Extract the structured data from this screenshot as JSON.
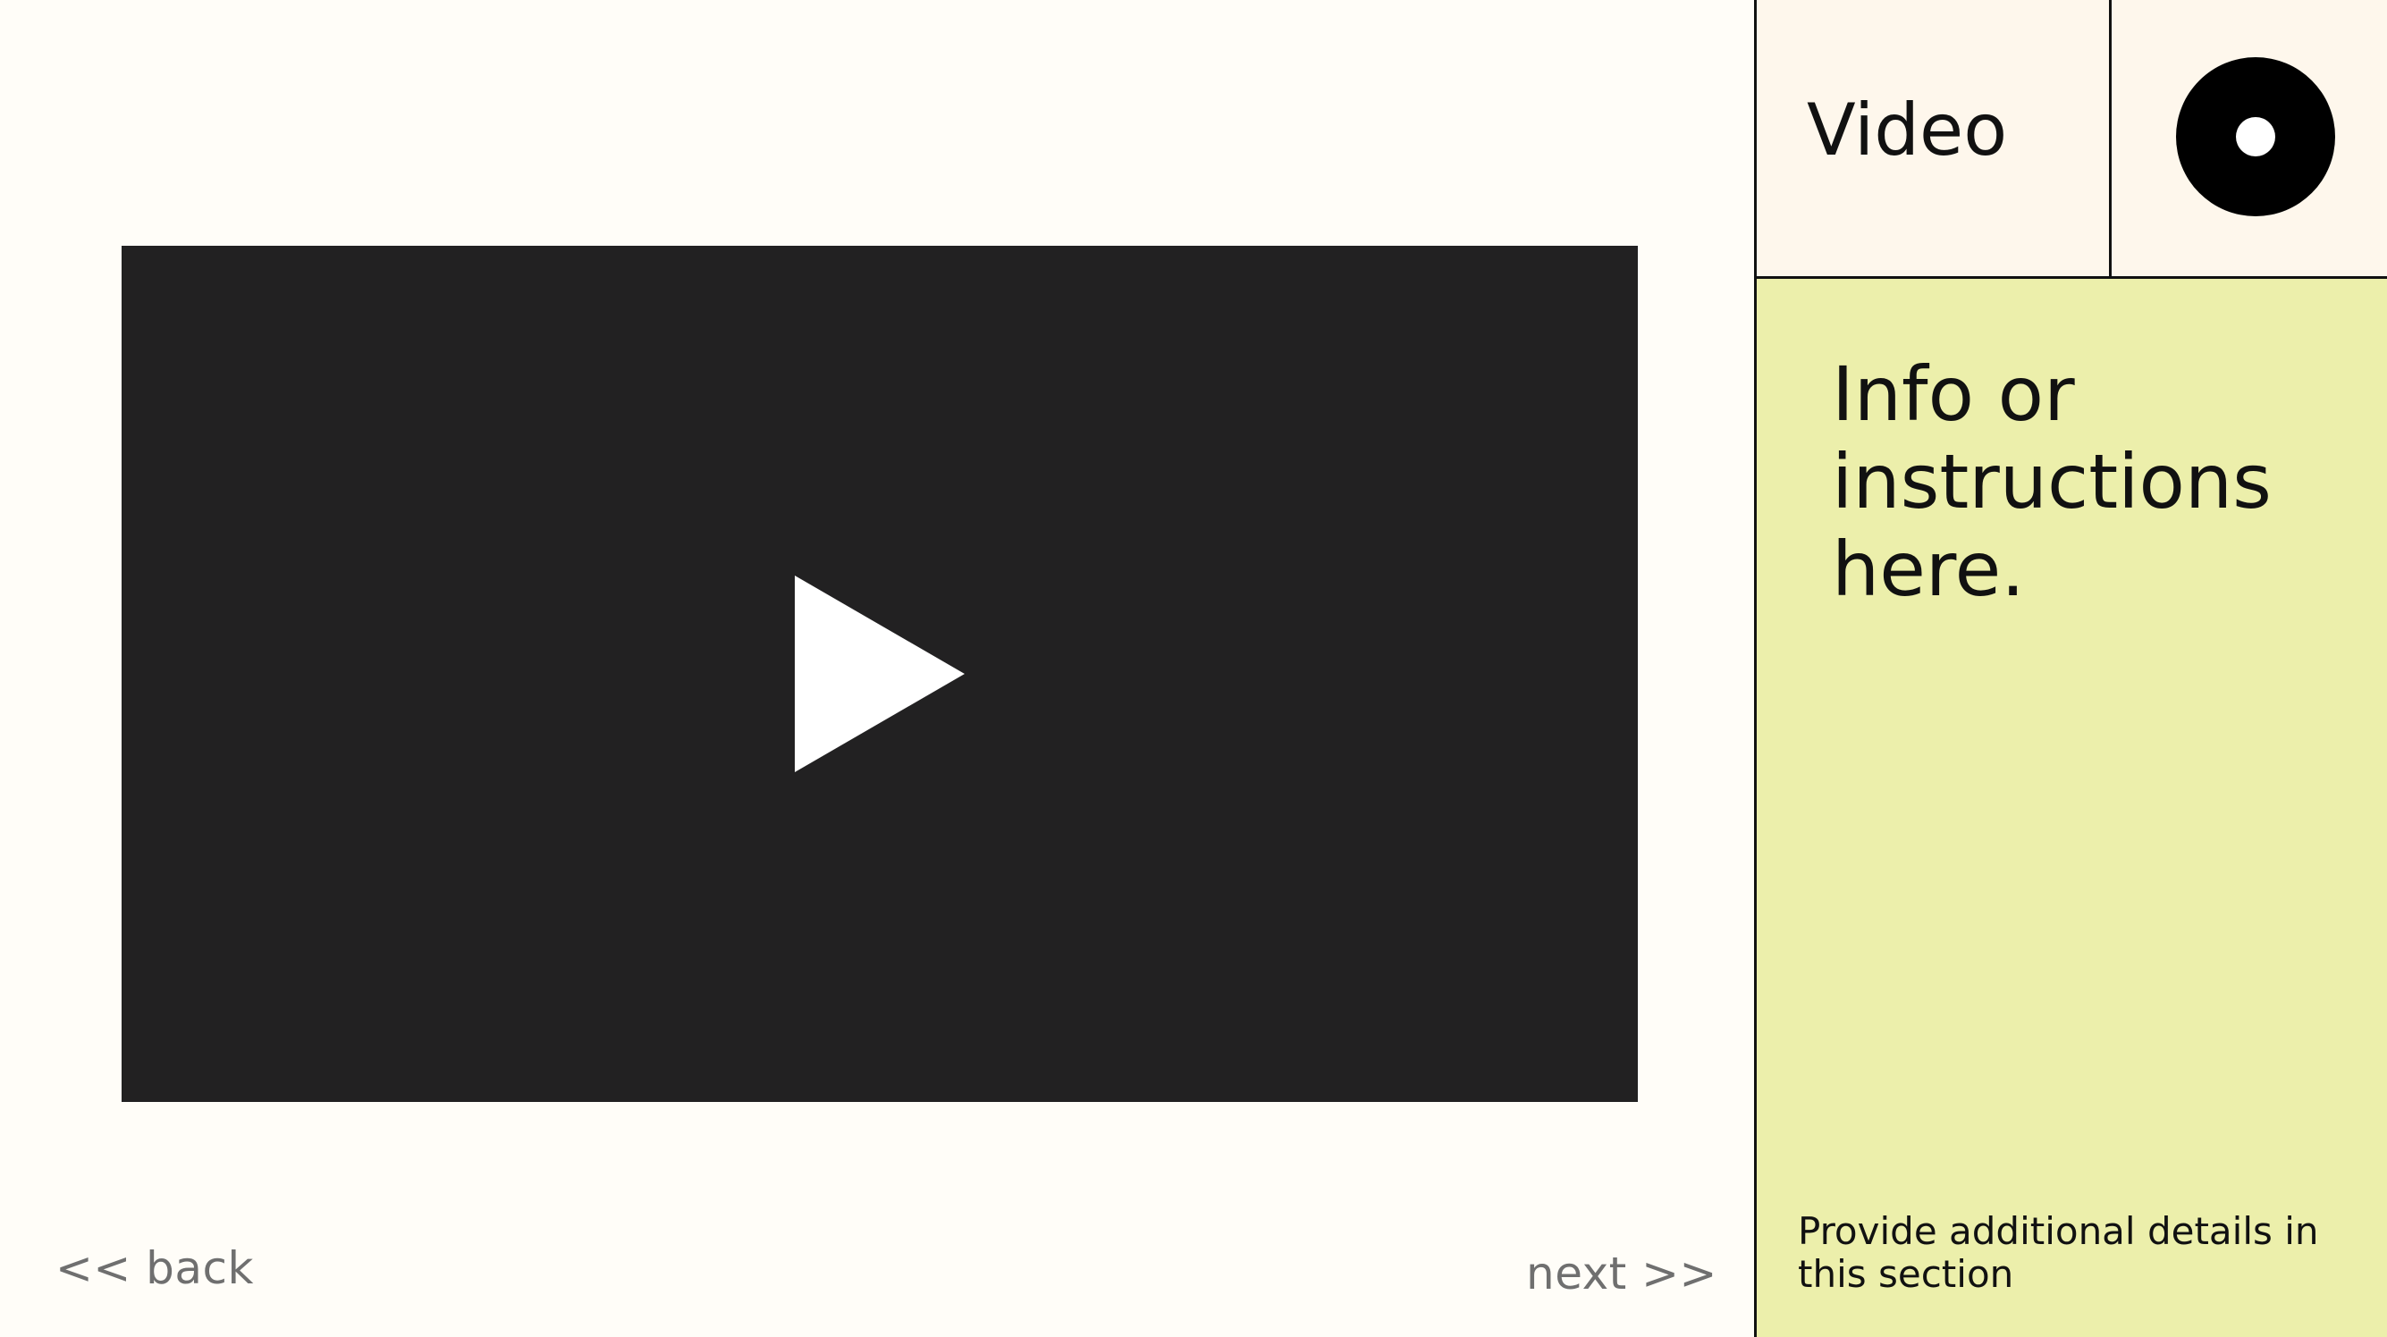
{
  "navigation": {
    "back_label": "<< back",
    "next_label": "next >>"
  },
  "video": {
    "play_icon": "play-icon"
  },
  "header": {
    "title": "Video",
    "icon": "record-icon"
  },
  "info": {
    "heading": "Info or instructions here.",
    "details": "Provide additional details in this section"
  },
  "colors": {
    "page_background": "#fffdf8",
    "video_background": "#222122",
    "header_background": "#fef7ec",
    "info_background": "#ecefab",
    "nav_text": "#6f6f6f",
    "ink": "#111111"
  }
}
